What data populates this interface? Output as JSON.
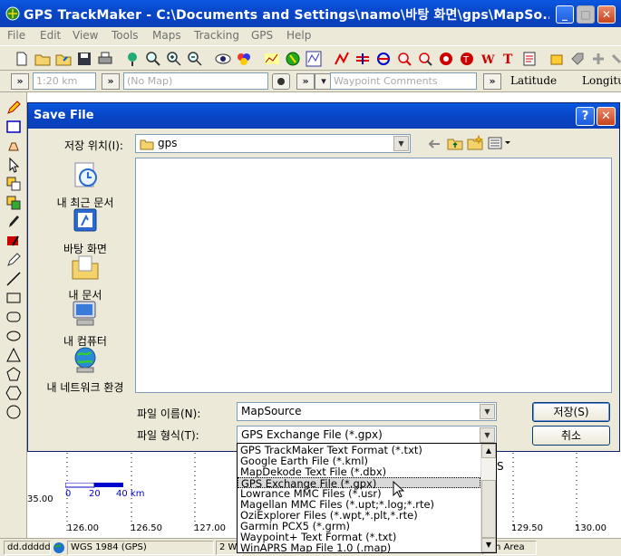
{
  "window": {
    "title": "GPS TrackMaker - C:\\Documents and Settings\\namo\\바탕 화면\\gps\\MapSo...",
    "min_label": "_",
    "max_label": "□",
    "close_label": "✕"
  },
  "menu": [
    "File",
    "Edit",
    "View",
    "Tools",
    "Maps",
    "Tracking",
    "GPS",
    "Help"
  ],
  "toolbar2": {
    "scale_value": "1:20 km",
    "map_value": "(No Map)",
    "waypoint_comments": "Waypoint Comments",
    "latitude": "Latitude",
    "longitude": "Longitu",
    "go_label": "»",
    "dropdown_label": "▾"
  },
  "map": {
    "lat_label": "35.00",
    "ticks": [
      "126.00",
      "126.50",
      "127.00",
      "129.50",
      "130.00"
    ],
    "scale_labels": [
      "0",
      "20",
      "40 km"
    ],
    "fragment_letter": "S"
  },
  "status": {
    "coords": "dd.ddddd",
    "datum": "WGS 1984 (GPS)",
    "segment": "2 W",
    "area": "tan Area"
  },
  "dialog": {
    "title": "Save File",
    "help_label": "?",
    "close_label": "✕",
    "location_label": "저장 위치(I):",
    "location_value": "gps",
    "places": [
      {
        "label": "내 최근 문서"
      },
      {
        "label": "바탕 화면"
      },
      {
        "label": "내 문서"
      },
      {
        "label": "내 컴퓨터"
      },
      {
        "label": "내 네트워크 환경"
      }
    ],
    "filename_label": "파일 이름(N):",
    "filename_value": "MapSource",
    "filetype_label": "파일 형식(T):",
    "filetype_value": "GPS Exchange File (*.gpx)",
    "save_button": "저장(S)",
    "cancel_button": "취소"
  },
  "filetype_options": [
    "GPS TrackMaker Text Format (*.txt)",
    "Google Earth File (*.kml)",
    "MapDekode Text File (*.dbx)",
    "GPS Exchange File (*.gpx)",
    "Lowrance MMC Files (*.usr)",
    "Magellan MMC Files (*.upt;*.log;*.rte)",
    "OziExplorer Files (*.wpt,*.plt,*.rte)",
    "Garmin PCX5 (*.grm)",
    "Waypoint+ Text Format (*.txt)",
    "WinAPRS Map File 1.0 (.map)"
  ],
  "selected_filetype_index": 3,
  "colors": {
    "titlebar": "#0846c8",
    "selection": "#d9d9d9"
  }
}
